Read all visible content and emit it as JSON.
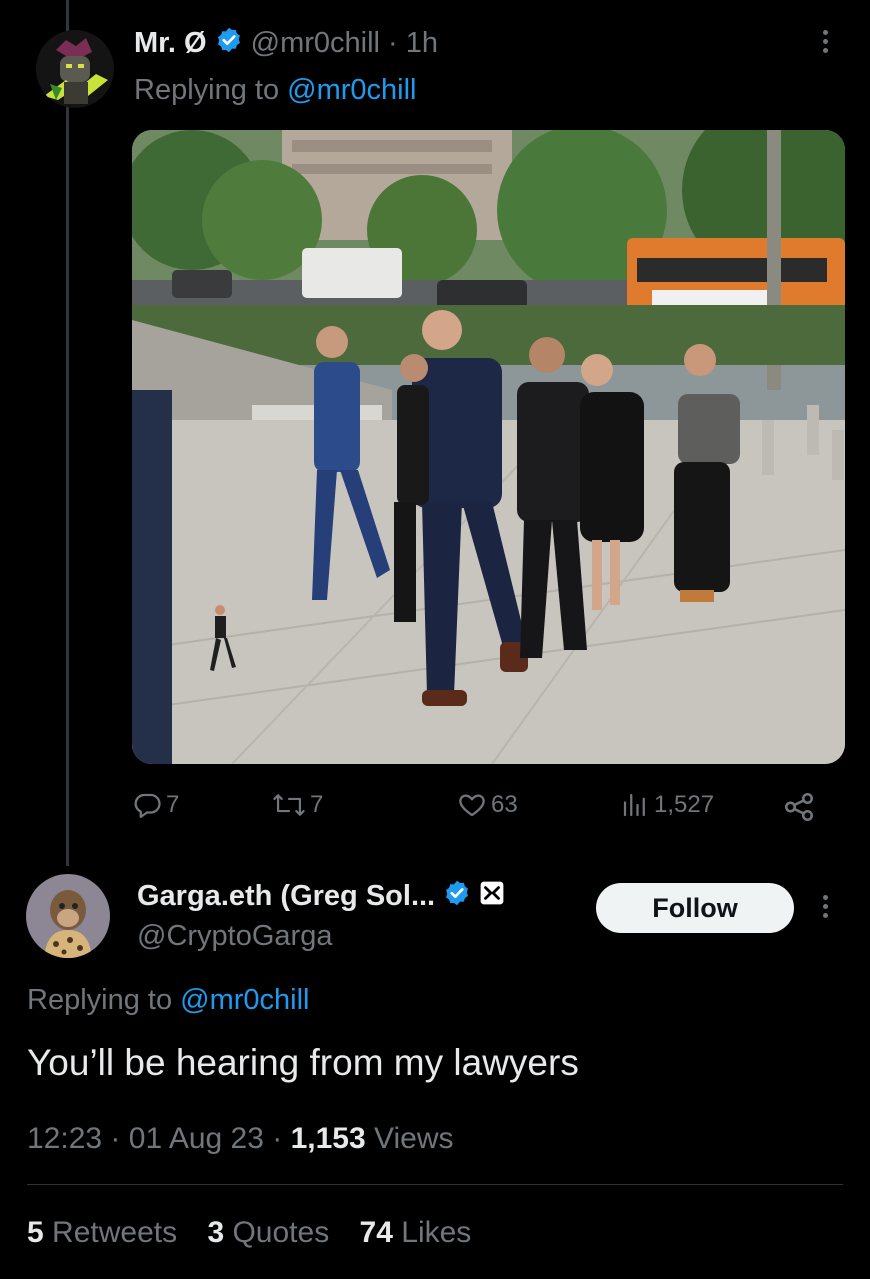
{
  "tweet1": {
    "display_name": "Mr. Ø",
    "handle": "@mr0chill",
    "separator": "·",
    "time": "1h",
    "replying_prefix": "Replying to",
    "replying_handle": "@mr0chill",
    "image_icon": "photo-courthouse-street",
    "actions": {
      "replies": "7",
      "retweets": "7",
      "likes": "63",
      "views": "1,527"
    }
  },
  "tweet2": {
    "display_name": "Garga.eth (Greg Sol...",
    "handle": "@CryptoGarga",
    "follow_label": "Follow",
    "replying_prefix": "Replying to",
    "replying_handle": "@mr0chill",
    "text": "You’ll be hearing from my lawyers",
    "time": "12:23",
    "date": "01 Aug 23",
    "dot": "·",
    "views_count": "1,153",
    "views_label": "Views",
    "retweets_count": "5",
    "retweets_label": "Retweets",
    "quotes_count": "3",
    "quotes_label": "Quotes",
    "likes_count": "74",
    "likes_label": "Likes"
  },
  "colors": {
    "background": "#000000",
    "text": "#e7e9ea",
    "muted": "#71767b",
    "link": "#1d9bf0",
    "verified": "#1d9bf0",
    "follow_bg": "#eff3f4"
  }
}
